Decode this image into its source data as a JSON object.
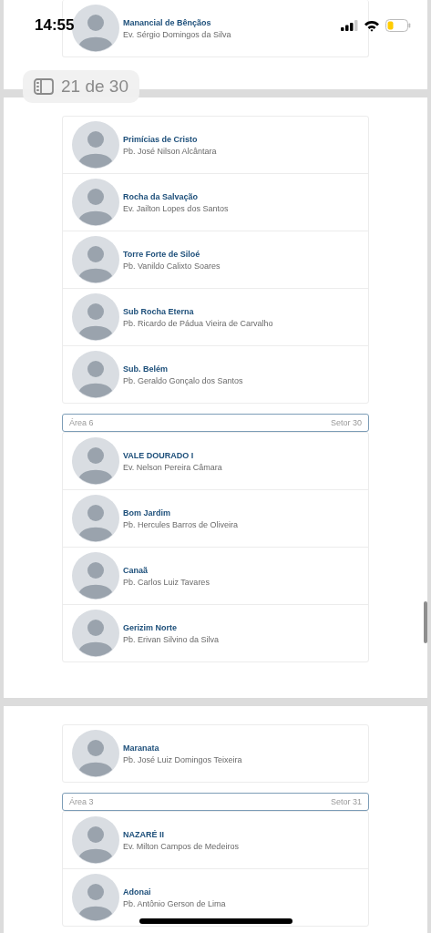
{
  "status_bar": {
    "time": "14:55"
  },
  "page_indicator": {
    "text": "21 de 30"
  },
  "pages": [
    {
      "groups": [
        {
          "entries": [
            {
              "church": "Manancial de Bênçãos",
              "pastor": "Ev. Sérgio Domingos da Silva"
            }
          ]
        }
      ]
    },
    {
      "groups": [
        {
          "entries": [
            {
              "church": "Primícias de Cristo",
              "pastor": "Pb. José Nilson Alcântara"
            },
            {
              "church": "Rocha da Salvação",
              "pastor": "Ev. Jailton Lopes dos Santos"
            },
            {
              "church": "Torre Forte de Siloé",
              "pastor": "Pb. Vanildo Calixto Soares"
            },
            {
              "church": "Sub Rocha Eterna",
              "pastor": "Pb. Ricardo de Pádua Vieira de Carvalho"
            },
            {
              "church": "Sub. Belém",
              "pastor": "Pb. Geraldo Gonçalo dos Santos"
            }
          ]
        },
        {
          "area": "Área 6",
          "sector": "Setor 30",
          "entries": [
            {
              "church": "VALE DOURADO I",
              "pastor": "Ev. Nelson Pereira Câmara"
            },
            {
              "church": "Bom Jardim",
              "pastor": "Pb. Hercules Barros de Oliveira"
            },
            {
              "church": "Canaã",
              "pastor": "Pb. Carlos Luiz Tavares"
            },
            {
              "church": "Gerizim Norte",
              "pastor": "Pb. Erivan Silvino da Silva"
            }
          ]
        }
      ]
    },
    {
      "groups": [
        {
          "entries": [
            {
              "church": "Maranata",
              "pastor": "Pb. José Luiz Domingos Teixeira"
            }
          ]
        },
        {
          "area": "Área 3",
          "sector": "Setor 31",
          "entries": [
            {
              "church": "NAZARÉ II",
              "pastor": "Ev. Milton Campos de Medeiros"
            },
            {
              "church": "Adonai",
              "pastor": "Pb. Antônio Gerson de Lima"
            }
          ]
        }
      ]
    }
  ]
}
